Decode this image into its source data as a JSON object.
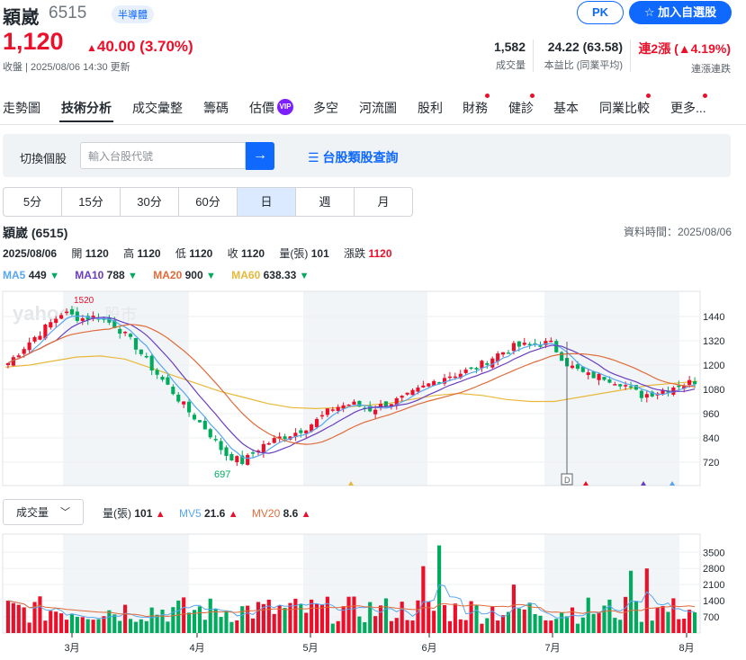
{
  "header": {
    "name": "穎崴",
    "code": "6515",
    "industry_tag": "半導體",
    "pk_label": "PK",
    "add_watchlist_label": "加入自選股",
    "price": "1,120",
    "change": "40.00",
    "change_pct": "(3.70%)",
    "update_text": "收盤 | 2025/08/06 14:30 更新",
    "stats": [
      {
        "value": "1,582",
        "label": "成交量"
      },
      {
        "value": "24.22 (63.58)",
        "label": "本益比 (同業平均)"
      },
      {
        "value": "連2漲 (▲4.19%)",
        "label": "連漲連跌"
      }
    ]
  },
  "tabs": [
    "走勢圖",
    "技術分析",
    "成交彙整",
    "籌碼",
    "估價",
    "多空",
    "河流圖",
    "股利",
    "財務",
    "健診",
    "基本",
    "同業比較",
    "更多..."
  ],
  "vip_badge": "VIP",
  "search": {
    "label": "切換個股",
    "placeholder": "輸入台股代號",
    "category_link": "台股類股查詢"
  },
  "periods": [
    "5分",
    "15分",
    "30分",
    "60分",
    "日",
    "週",
    "月"
  ],
  "selected_period": "日",
  "info": {
    "stock_title": "穎崴 (6515)",
    "data_time": "資料時間：2025/08/06",
    "date": "2025/08/06",
    "open_label": "開",
    "open": "1120",
    "high_label": "高",
    "high": "1120",
    "low_label": "低",
    "low": "1120",
    "close_label": "收",
    "close": "1120",
    "vol_label": "量(張)",
    "vol": "101",
    "chg_label": "漲跌",
    "chg": "1120"
  },
  "ma": [
    {
      "label": "MA5",
      "value": "449",
      "color": "#58a6f0",
      "dir": "down"
    },
    {
      "label": "MA10",
      "value": "788",
      "color": "#6a3cc1",
      "dir": "down"
    },
    {
      "label": "MA20",
      "value": "900",
      "color": "#e06b3a",
      "dir": "down"
    },
    {
      "label": "MA60",
      "value": "638.33",
      "color": "#e8b83a",
      "dir": "down"
    }
  ],
  "volume": {
    "selector": "成交量",
    "items": [
      {
        "label": "量(張)",
        "value": "101",
        "color": "#232a31",
        "dir": "up"
      },
      {
        "label": "MV5",
        "value": "21.6",
        "color": "#58a6f0",
        "dir": "up"
      },
      {
        "label": "MV20",
        "value": "8.6",
        "color": "#e06b3a",
        "dir": "up"
      }
    ]
  },
  "watermark": "股市",
  "colors": {
    "up": "#eb0f29",
    "down": "#00ab5e",
    "accent": "#0f69ff",
    "ma5": "#58a6f0",
    "ma10": "#6a3cc1",
    "ma20": "#e06b3a",
    "ma60": "#e8b83a"
  },
  "chart_data": {
    "type": "candlestick",
    "price_axis_ticks": [
      720,
      840,
      960,
      1080,
      1200,
      1320,
      1440
    ],
    "volume_axis_ticks": [
      700,
      1400,
      2100,
      2800,
      3500
    ],
    "month_labels": [
      "3月",
      "4月",
      "5月",
      "6月",
      "7月",
      "8月"
    ],
    "annotations": {
      "high": "1520",
      "low": "697",
      "marker": "D"
    },
    "close_path": [
      1210,
      1300,
      1380,
      1460,
      1430,
      1440,
      1390,
      1300,
      1180,
      1080,
      970,
      880,
      760,
      720,
      800,
      840,
      870,
      920,
      990,
      1010,
      980,
      1010,
      1040,
      1090,
      1140,
      1160,
      1190,
      1250,
      1290,
      1300,
      1310,
      1200,
      1150,
      1140,
      1110,
      1050,
      1070,
      1100,
      1120
    ],
    "ma60_path": [
      1190,
      1200,
      1220,
      1240,
      1245,
      1230,
      1190,
      1150,
      1110,
      1070,
      1040,
      1010,
      990,
      985,
      990,
      1000,
      1010,
      1030,
      1050,
      1060,
      1050,
      1030,
      1020,
      1020,
      1040,
      1060,
      1080,
      1100,
      1110,
      1120
    ]
  }
}
